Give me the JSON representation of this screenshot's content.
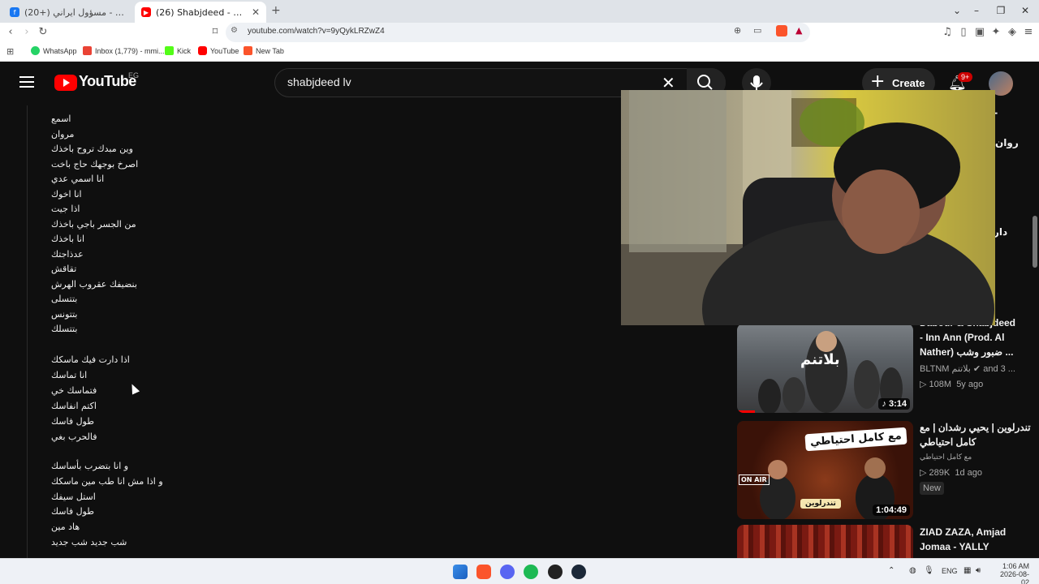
{
  "browser": {
    "tabs": [
      {
        "label": "(20+) ضياء أبو عون - مسؤول ايراني : ..."
      },
      {
        "label": "(26) Shabjdeed - SLV (Prod. S..."
      }
    ],
    "url": "youtube.com/watch?v=9yQykLRZwZ4",
    "bookmarks": [
      "WhatsApp",
      "Inbox (1,779) - mmi...",
      "Kick",
      "YouTube",
      "New Tab"
    ]
  },
  "youtube": {
    "logo": "YouTube",
    "region": "EG",
    "search_value": "shabjdeed lv",
    "create_label": "Create",
    "notif_count": "9+"
  },
  "lyrics": [
    "اسمع",
    "مروان",
    "وين مبدك تروح باخذك",
    "اصرخ بوجهك حاج باخت",
    "انا اسمي عدي",
    "انا اخوك",
    "اذا جيت",
    "من الجسر باجي باخذك",
    "انا باخذك",
    "عدذاجتك",
    "تقاقش",
    "بنضيفك عقروب الهرش",
    "بتتسلى",
    "بتتونس",
    "بتتسلك",
    "اذا دارت فيك ماسكك",
    "انا تماسك",
    "فتماسك خي",
    "اكتم انفاسك",
    "طول فاسك",
    "فالحرب بغي",
    "و انا بتضرب بأساسك",
    "و اذا مش انا طب مين ماسكك",
    "استل سيفك",
    "طول فاسك",
    "هاد مين",
    "شب جديد شب جديد"
  ],
  "related": [
    {
      "title_lines": [
        "Dabour & Shabjdeed",
        "- Inn Ann (Prod. Al",
        "Nather) ضبور وشب ..."
      ],
      "channel": "BLTNM بلاتنم",
      "extra": "and 3 ...",
      "views": "108M",
      "age": "5y ago",
      "duration": "3:14",
      "thumb_text": "بلاتنم"
    },
    {
      "title_lines": [
        "تندرلوين | يحيي رشدان | مع",
        "كامل احتياطي"
      ],
      "channel": "مع كامل احتياطي",
      "views": "289K",
      "age": "1d ago",
      "duration": "1:04:49",
      "badge": "New",
      "thumb_text": "مع كامل احتياطي",
      "thumb_sub": "تندرلوين",
      "thumb_tag": "ON AIR"
    },
    {
      "title_lines": [
        "ZIAD ZAZA, Amjad",
        "Jomaa - YALLY"
      ]
    }
  ],
  "partial_right": {
    "a": "a -",
    "b": "روان",
    "c": "دار"
  },
  "taskbar": {
    "lang": "ENG",
    "time": "1:06 AM",
    "date": "2026-08-02"
  }
}
